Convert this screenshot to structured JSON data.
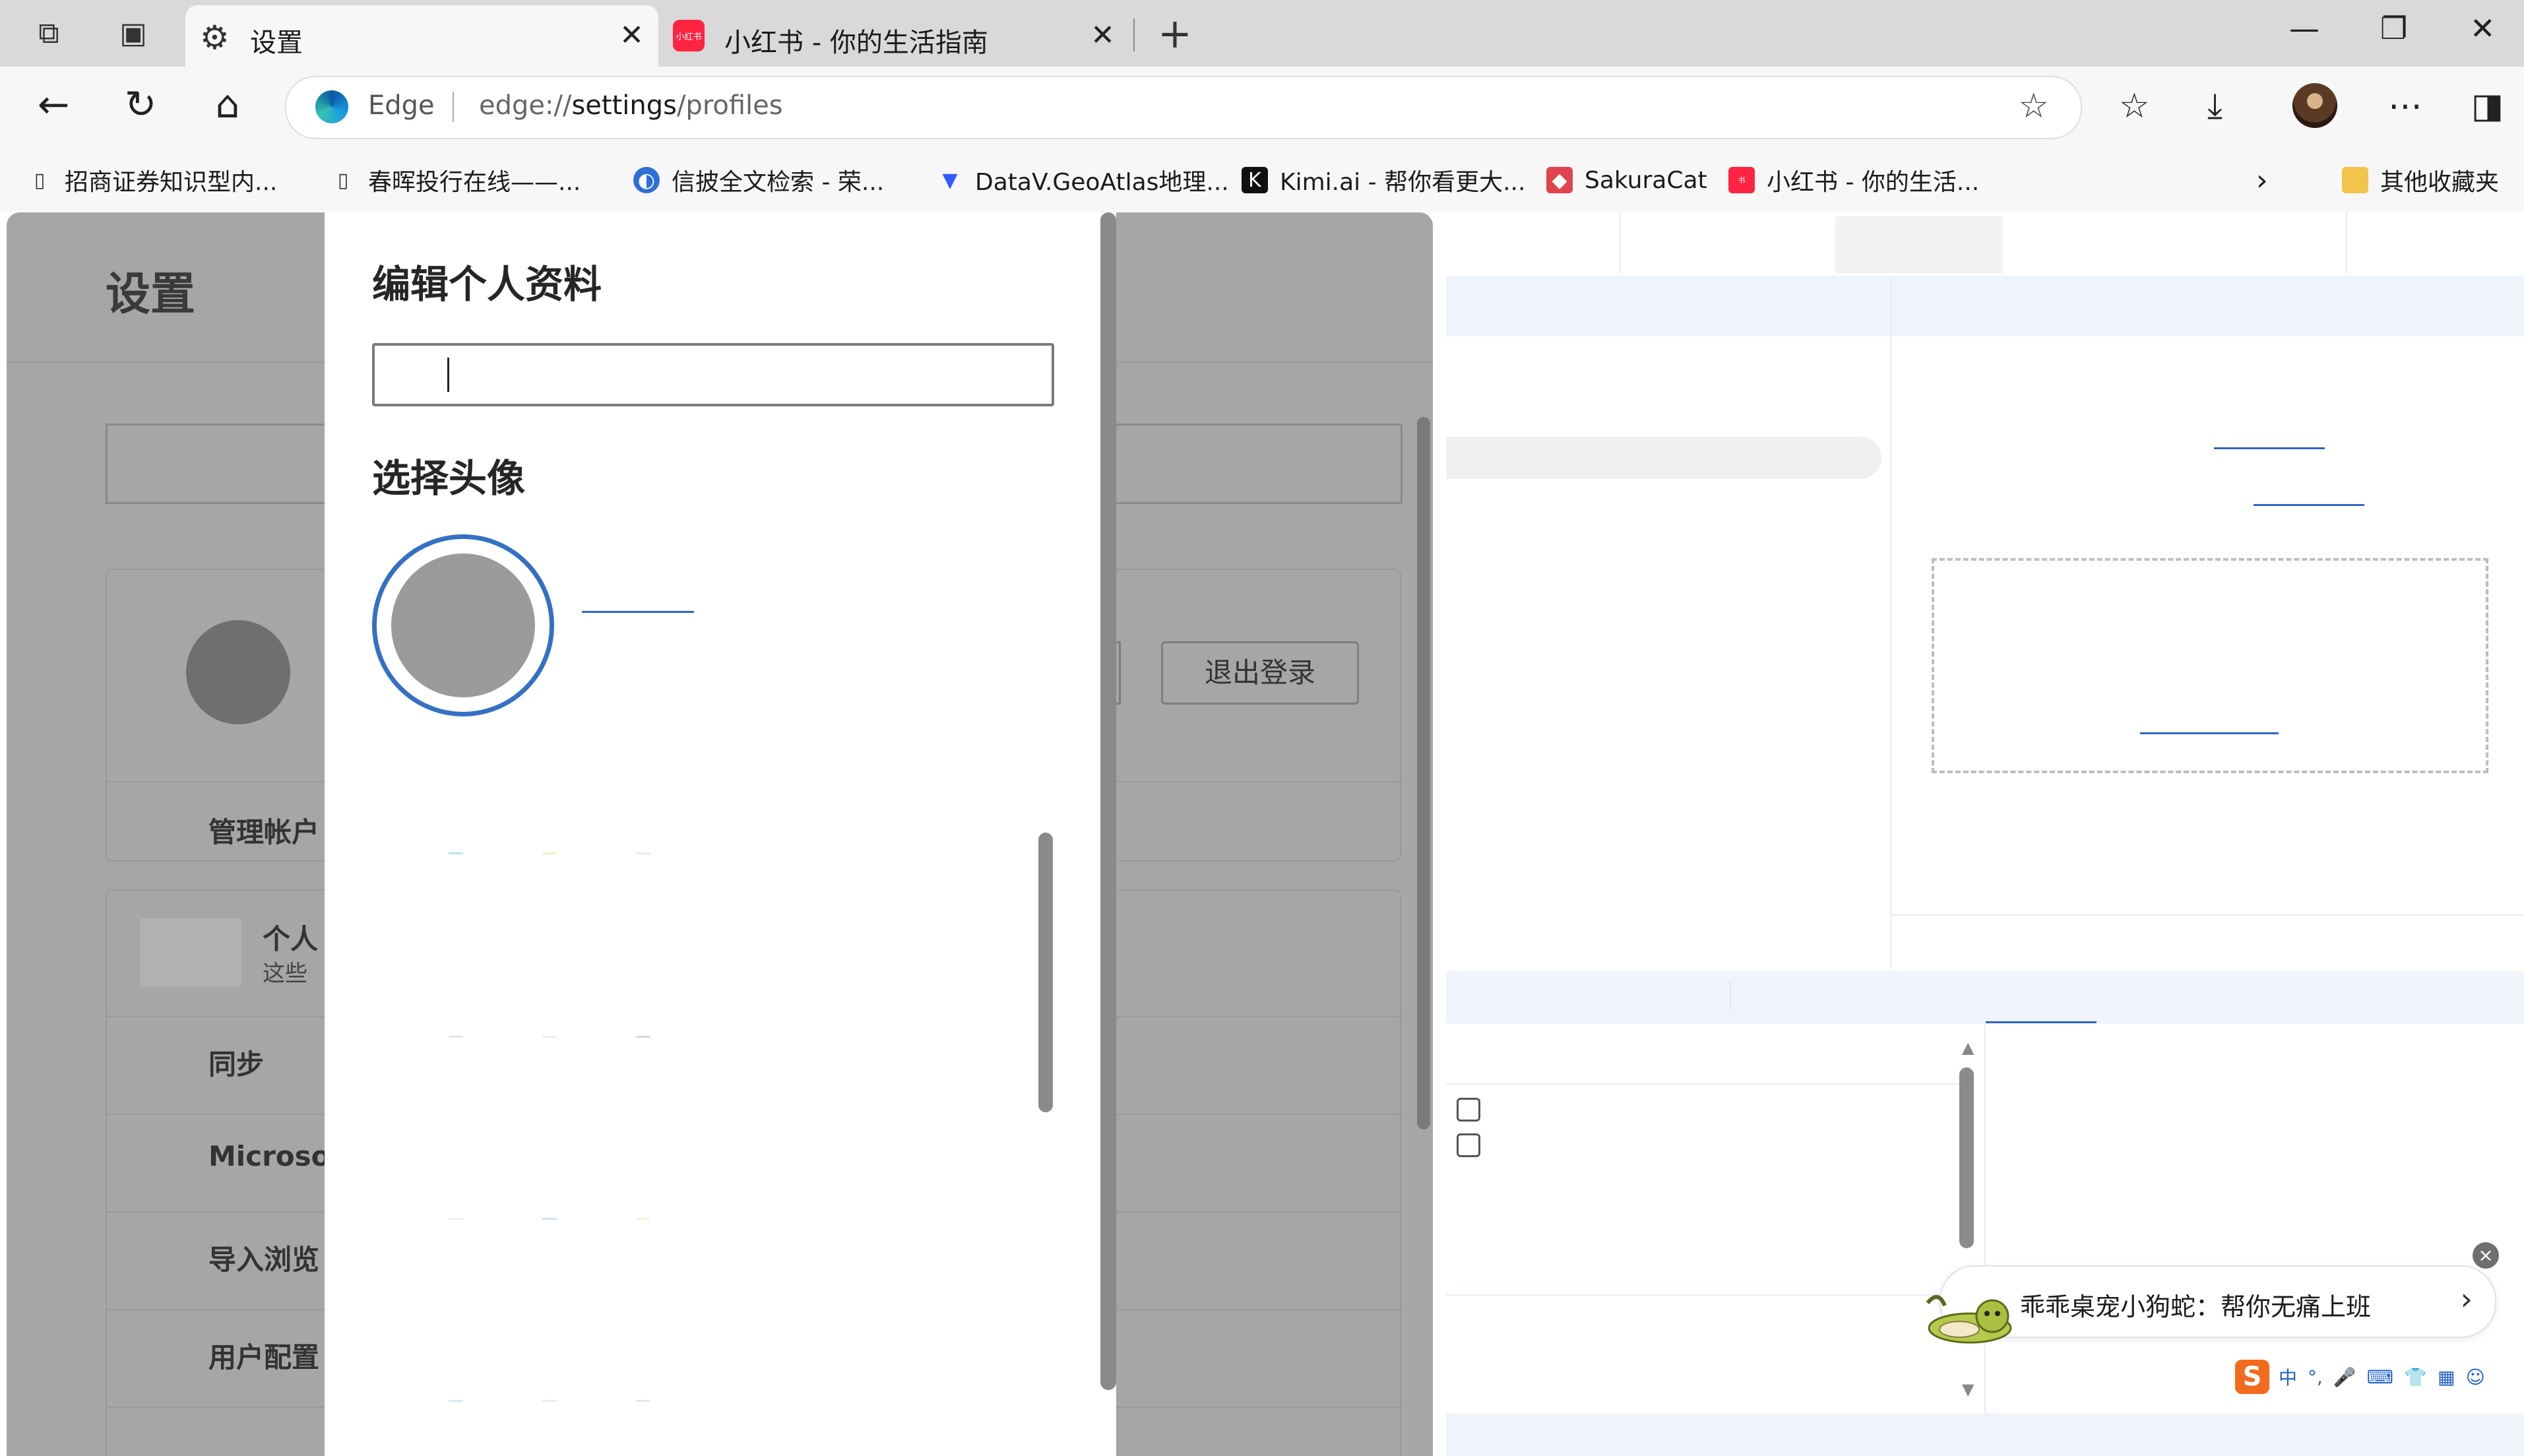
{
  "browser": {
    "tabs": [
      {
        "title": "设置",
        "icon": "gear-icon",
        "active": true
      },
      {
        "title": "小红书 - 你的生活指南",
        "icon": "xiaohongshu-favicon",
        "favicon_text": "小红书",
        "active": false
      }
    ],
    "address": {
      "brand": "Edge",
      "url_prefix": "edge://",
      "url_main": "settings",
      "url_suffix": "/profiles"
    },
    "favorites": [
      {
        "label": "招商证券知识型内...",
        "icon": "document-icon"
      },
      {
        "label": "春晖投行在线——...",
        "icon": "document-icon"
      },
      {
        "label": "信披全文检索 - 荣...",
        "icon": "globe-icon"
      },
      {
        "label": "DataV.GeoAtlas地理...",
        "icon": "datav-icon"
      },
      {
        "label": "Kimi.ai - 帮你看更大...",
        "icon": "kimi-icon"
      },
      {
        "label": "SakuraCat",
        "icon": "sakuracat-icon"
      },
      {
        "label": "小红书 - 你的生活...",
        "icon": "xiaohongshu-favicon"
      }
    ],
    "other_favorites": "其他收藏夹"
  },
  "settings": {
    "title": "设置",
    "signout_label": "退出登录",
    "manage_account": "管理帐户",
    "personal_info": "个人",
    "personal_info_sub": "这些",
    "rows": [
      "同步",
      "Microso",
      "导入浏览",
      "用户配置"
    ]
  },
  "dialog": {
    "title": "编辑个人资料",
    "name_value": "",
    "avatar_section": "选择头像"
  },
  "pet_widget": {
    "text": "乖乖桌宠小狗蛇：帮你无痛上班",
    "close_symbol": "×"
  },
  "ime": {
    "items": [
      "中",
      "°,",
      "🎤",
      "⌨",
      "👕",
      "▦",
      "☺"
    ]
  }
}
